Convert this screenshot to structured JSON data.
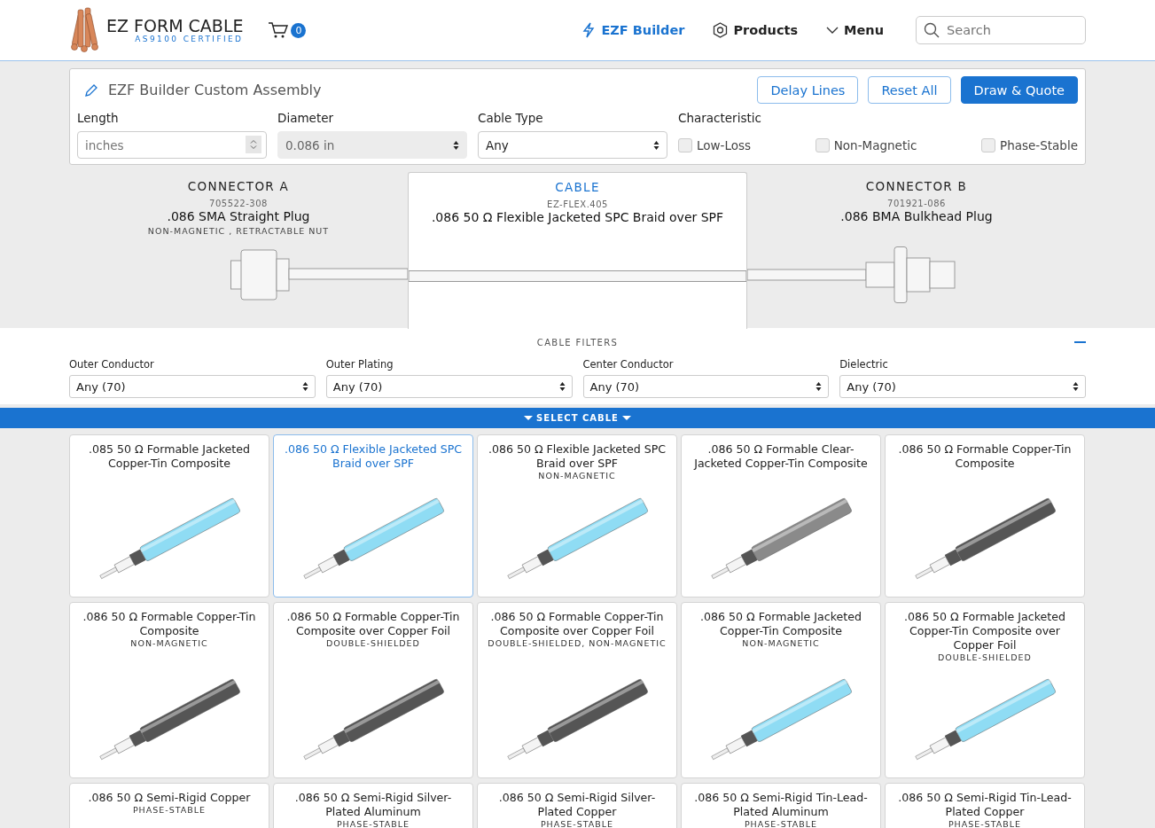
{
  "header": {
    "brand": "EZ FORM CABLE",
    "tagline": "AS9100 CERTIFIED",
    "cart_count": "0",
    "nav": [
      {
        "label": "EZF Builder",
        "kind": "builder",
        "selected": true
      },
      {
        "label": "Products",
        "kind": "products",
        "selected": false
      },
      {
        "label": "Menu",
        "kind": "menu",
        "selected": false
      }
    ],
    "search": {
      "placeholder": "Search"
    }
  },
  "builder": {
    "title": "EZF Builder Custom Assembly",
    "buttons": [
      {
        "label": "Delay Lines",
        "primary": false
      },
      {
        "label": "Reset All",
        "primary": false
      },
      {
        "label": "Draw & Quote",
        "primary": true
      }
    ],
    "length": {
      "label": "Length",
      "placeholder": "inches"
    },
    "diameter": {
      "label": "Diameter",
      "value": "0.086 in",
      "disabled": true
    },
    "cable_type": {
      "label": "Cable Type",
      "value": "Any",
      "disabled": false
    },
    "characteristic": {
      "label": "Characteristic",
      "options": [
        {
          "label": "Low-Loss",
          "checked": false
        },
        {
          "label": "Non-Magnetic",
          "checked": false
        },
        {
          "label": "Phase-Stable",
          "checked": false
        }
      ]
    }
  },
  "assembly": [
    {
      "heading": "CONNECTOR A",
      "part": "705522-308",
      "name": ".086 SMA Straight Plug",
      "note": "NON-MAGNETIC , RETRACTABLE NUT",
      "kind": "sma",
      "selected": false
    },
    {
      "heading": "CABLE",
      "part": "EZ-FLEX.405",
      "name": ".086 50 Ω Flexible Jacketed SPC Braid over SPF",
      "kind": "cable",
      "selected": true
    },
    {
      "heading": "CONNECTOR B",
      "part": "701921-086",
      "name": ".086 BMA Bulkhead Plug",
      "kind": "bma",
      "selected": false
    }
  ],
  "filters": {
    "title": "CABLE FILTERS",
    "items": [
      {
        "label": "Outer Conductor",
        "value": "Any (70)"
      },
      {
        "label": "Outer Plating",
        "value": "Any (70)"
      },
      {
        "label": "Center Conductor",
        "value": "Any (70)"
      },
      {
        "label": "Dielectric",
        "value": "Any (70)"
      }
    ]
  },
  "select_bar": {
    "label": "SELECT CABLE"
  },
  "cables": [
    {
      "title": ".085 50 Ω Formable Jacketed Copper-Tin Composite",
      "kind": "jacketed",
      "selected": false
    },
    {
      "title": ".086 50 Ω Flexible Jacketed SPC Braid over SPF",
      "kind": "jacketed",
      "selected": true
    },
    {
      "title": ".086 50 Ω Flexible Jacketed SPC Braid over SPF",
      "tag": "NON-MAGNETIC",
      "kind": "jacketed",
      "selected": false
    },
    {
      "title": ".086 50 Ω Formable Clear-Jacketed Copper-Tin Composite",
      "kind": "clear",
      "selected": false
    },
    {
      "title": ".086 50 Ω Formable Copper-Tin Composite",
      "kind": "braided",
      "selected": false
    },
    {
      "title": ".086 50 Ω Formable Copper-Tin Composite",
      "tag": "NON-MAGNETIC",
      "kind": "braided",
      "selected": false
    },
    {
      "title": ".086 50 Ω Formable Copper-Tin Composite over Copper Foil",
      "tag": "DOUBLE-SHIELDED",
      "kind": "braided",
      "selected": false
    },
    {
      "title": ".086 50 Ω Formable Copper-Tin Composite over Copper Foil",
      "tag": "DOUBLE-SHIELDED, NON-MAGNETIC",
      "kind": "braided",
      "selected": false
    },
    {
      "title": ".086 50 Ω Formable Jacketed Copper-Tin Composite",
      "tag": "NON-MAGNETIC",
      "kind": "jacketed",
      "selected": false
    },
    {
      "title": ".086 50 Ω Formable Jacketed Copper-Tin Composite over Copper Foil",
      "tag": "DOUBLE-SHIELDED",
      "kind": "jacketed",
      "selected": false
    },
    {
      "title": ".086 50 Ω Semi-Rigid Copper",
      "tag": "PHASE-STABLE",
      "kind": "hidden",
      "selected": false
    },
    {
      "title": ".086 50 Ω Semi-Rigid Silver-Plated Aluminum",
      "tag": "PHASE-STABLE",
      "kind": "hidden",
      "selected": false
    },
    {
      "title": ".086 50 Ω Semi-Rigid Silver-Plated Copper",
      "tag": "PHASE-STABLE",
      "kind": "hidden",
      "selected": false
    },
    {
      "title": ".086 50 Ω Semi-Rigid Tin-Lead-Plated Aluminum",
      "tag": "PHASE-STABLE",
      "kind": "hidden",
      "selected": false
    },
    {
      "title": ".086 50 Ω Semi-Rigid Tin-Lead-Plated Copper",
      "tag": "PHASE-STABLE",
      "kind": "hidden",
      "selected": false
    }
  ]
}
